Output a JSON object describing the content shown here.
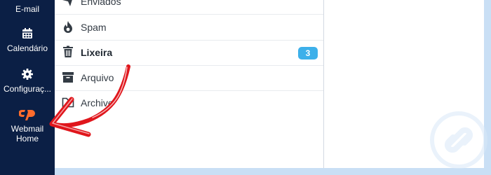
{
  "sidebar": {
    "items": [
      {
        "label": "E-mail",
        "icon": "envelope-icon"
      },
      {
        "label": "Calendário",
        "icon": "calendar-icon"
      },
      {
        "label": "Configuraç...",
        "icon": "gear-icon"
      },
      {
        "label": "Webmail Home",
        "icon": "cpanel-icon"
      }
    ]
  },
  "folders": {
    "items": [
      {
        "label": "Enviados",
        "icon": "send-icon"
      },
      {
        "label": "Spam",
        "icon": "fire-icon"
      },
      {
        "label": "Lixeira",
        "icon": "trash-icon",
        "count": "3"
      },
      {
        "label": "Arquivo",
        "icon": "archive-icon"
      },
      {
        "label": "Archive",
        "icon": "folder-icon"
      }
    ]
  },
  "colors": {
    "sidebar_bg": "#0b1f45",
    "accent_orange": "#ff6c2c",
    "badge_blue": "#3db0ea",
    "annotation_red": "#e0161c"
  }
}
